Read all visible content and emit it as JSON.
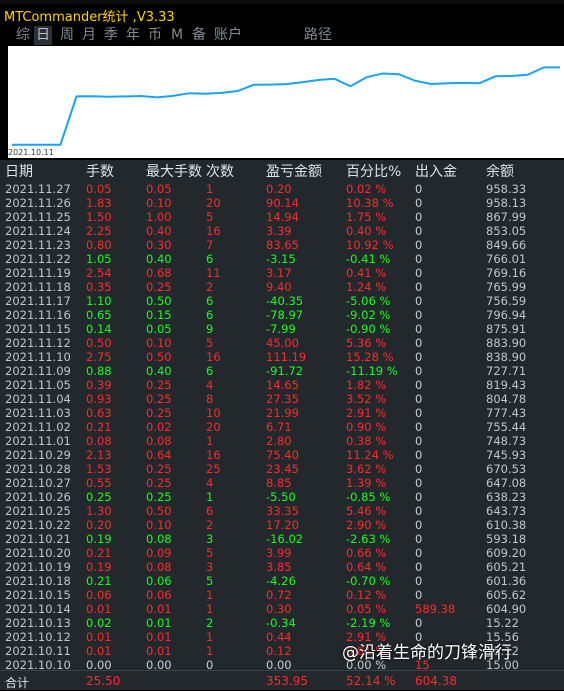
{
  "window": {
    "title": "MTCommander统计 ,V3.33"
  },
  "tabs": [
    {
      "label": "综",
      "selected": false
    },
    {
      "label": "日",
      "selected": true
    },
    {
      "label": "周",
      "selected": false
    },
    {
      "label": "月",
      "selected": false
    },
    {
      "label": "季",
      "selected": false
    },
    {
      "label": "年",
      "selected": false
    },
    {
      "label": "币",
      "selected": false
    },
    {
      "label": "M",
      "selected": false
    },
    {
      "label": "备",
      "selected": false
    },
    {
      "label": "账户",
      "selected": false
    },
    {
      "label": "路径",
      "selected": false
    }
  ],
  "chart": {
    "date_label": "2021.10.11"
  },
  "table": {
    "headers": [
      "日期",
      "手数",
      "最大手数",
      "次数",
      "盈亏金额",
      "百分比%",
      "出入金",
      "余额"
    ],
    "rows": [
      {
        "date": "2021.11.27",
        "lots": "0.05",
        "max_lots": "0.05",
        "count": "1",
        "pnl": "0.20",
        "pct": "0.02 %",
        "flow": "0",
        "balance": "958.33",
        "dir": "pos"
      },
      {
        "date": "2021.11.26",
        "lots": "1.83",
        "max_lots": "0.10",
        "count": "20",
        "pnl": "90.14",
        "pct": "10.38 %",
        "flow": "0",
        "balance": "958.13",
        "dir": "pos"
      },
      {
        "date": "2021.11.25",
        "lots": "1.50",
        "max_lots": "1.00",
        "count": "5",
        "pnl": "14.94",
        "pct": "1.75 %",
        "flow": "0",
        "balance": "867.99",
        "dir": "pos"
      },
      {
        "date": "2021.11.24",
        "lots": "2.25",
        "max_lots": "0.40",
        "count": "16",
        "pnl": "3.39",
        "pct": "0.40 %",
        "flow": "0",
        "balance": "853.05",
        "dir": "pos"
      },
      {
        "date": "2021.11.23",
        "lots": "0.80",
        "max_lots": "0.30",
        "count": "7",
        "pnl": "83.65",
        "pct": "10.92 %",
        "flow": "0",
        "balance": "849.66",
        "dir": "pos"
      },
      {
        "date": "2021.11.22",
        "lots": "1.05",
        "max_lots": "0.40",
        "count": "6",
        "pnl": "-3.15",
        "pct": "-0.41 %",
        "flow": "0",
        "balance": "766.01",
        "dir": "neg"
      },
      {
        "date": "2021.11.19",
        "lots": "2.54",
        "max_lots": "0.68",
        "count": "11",
        "pnl": "3.17",
        "pct": "0.41 %",
        "flow": "0",
        "balance": "769.16",
        "dir": "pos"
      },
      {
        "date": "2021.11.18",
        "lots": "0.35",
        "max_lots": "0.25",
        "count": "2",
        "pnl": "9.40",
        "pct": "1.24 %",
        "flow": "0",
        "balance": "765.99",
        "dir": "pos"
      },
      {
        "date": "2021.11.17",
        "lots": "1.10",
        "max_lots": "0.50",
        "count": "6",
        "pnl": "-40.35",
        "pct": "-5.06 %",
        "flow": "0",
        "balance": "756.59",
        "dir": "neg"
      },
      {
        "date": "2021.11.16",
        "lots": "0.65",
        "max_lots": "0.15",
        "count": "6",
        "pnl": "-78.97",
        "pct": "-9.02 %",
        "flow": "0",
        "balance": "796.94",
        "dir": "neg"
      },
      {
        "date": "2021.11.15",
        "lots": "0.14",
        "max_lots": "0.05",
        "count": "9",
        "pnl": "-7.99",
        "pct": "-0.90 %",
        "flow": "0",
        "balance": "875.91",
        "dir": "neg"
      },
      {
        "date": "2021.11.12",
        "lots": "0.50",
        "max_lots": "0.10",
        "count": "5",
        "pnl": "45.00",
        "pct": "5.36 %",
        "flow": "0",
        "balance": "883.90",
        "dir": "pos"
      },
      {
        "date": "2021.11.10",
        "lots": "2.75",
        "max_lots": "0.50",
        "count": "16",
        "pnl": "111.19",
        "pct": "15.28 %",
        "flow": "0",
        "balance": "838.90",
        "dir": "pos"
      },
      {
        "date": "2021.11.09",
        "lots": "0.88",
        "max_lots": "0.40",
        "count": "6",
        "pnl": "-91.72",
        "pct": "-11.19 %",
        "flow": "0",
        "balance": "727.71",
        "dir": "neg"
      },
      {
        "date": "2021.11.05",
        "lots": "0.39",
        "max_lots": "0.25",
        "count": "4",
        "pnl": "14.65",
        "pct": "1.82 %",
        "flow": "0",
        "balance": "819.43",
        "dir": "pos"
      },
      {
        "date": "2021.11.04",
        "lots": "0.93",
        "max_lots": "0.25",
        "count": "8",
        "pnl": "27.35",
        "pct": "3.52 %",
        "flow": "0",
        "balance": "804.78",
        "dir": "pos"
      },
      {
        "date": "2021.11.03",
        "lots": "0.63",
        "max_lots": "0.25",
        "count": "10",
        "pnl": "21.99",
        "pct": "2.91 %",
        "flow": "0",
        "balance": "777.43",
        "dir": "pos"
      },
      {
        "date": "2021.11.02",
        "lots": "0.21",
        "max_lots": "0.02",
        "count": "20",
        "pnl": "6.71",
        "pct": "0.90 %",
        "flow": "0",
        "balance": "755.44",
        "dir": "pos"
      },
      {
        "date": "2021.11.01",
        "lots": "0.08",
        "max_lots": "0.08",
        "count": "1",
        "pnl": "2.80",
        "pct": "0.38 %",
        "flow": "0",
        "balance": "748.73",
        "dir": "pos"
      },
      {
        "date": "2021.10.29",
        "lots": "2.13",
        "max_lots": "0.64",
        "count": "16",
        "pnl": "75.40",
        "pct": "11.24 %",
        "flow": "0",
        "balance": "745.93",
        "dir": "pos"
      },
      {
        "date": "2021.10.28",
        "lots": "1.53",
        "max_lots": "0.25",
        "count": "25",
        "pnl": "23.45",
        "pct": "3.62 %",
        "flow": "0",
        "balance": "670.53",
        "dir": "pos"
      },
      {
        "date": "2021.10.27",
        "lots": "0.55",
        "max_lots": "0.25",
        "count": "4",
        "pnl": "8.85",
        "pct": "1.39 %",
        "flow": "0",
        "balance": "647.08",
        "dir": "pos"
      },
      {
        "date": "2021.10.26",
        "lots": "0.25",
        "max_lots": "0.25",
        "count": "1",
        "pnl": "-5.50",
        "pct": "-0.85 %",
        "flow": "0",
        "balance": "638.23",
        "dir": "neg"
      },
      {
        "date": "2021.10.25",
        "lots": "1.30",
        "max_lots": "0.50",
        "count": "6",
        "pnl": "33.35",
        "pct": "5.46 %",
        "flow": "0",
        "balance": "643.73",
        "dir": "pos"
      },
      {
        "date": "2021.10.22",
        "lots": "0.20",
        "max_lots": "0.10",
        "count": "2",
        "pnl": "17.20",
        "pct": "2.90 %",
        "flow": "0",
        "balance": "610.38",
        "dir": "pos"
      },
      {
        "date": "2021.10.21",
        "lots": "0.19",
        "max_lots": "0.08",
        "count": "3",
        "pnl": "-16.02",
        "pct": "-2.63 %",
        "flow": "0",
        "balance": "593.18",
        "dir": "neg"
      },
      {
        "date": "2021.10.20",
        "lots": "0.21",
        "max_lots": "0.09",
        "count": "5",
        "pnl": "3.99",
        "pct": "0.66 %",
        "flow": "0",
        "balance": "609.20",
        "dir": "pos"
      },
      {
        "date": "2021.10.19",
        "lots": "0.19",
        "max_lots": "0.08",
        "count": "3",
        "pnl": "3.85",
        "pct": "0.64 %",
        "flow": "0",
        "balance": "605.21",
        "dir": "pos"
      },
      {
        "date": "2021.10.18",
        "lots": "0.21",
        "max_lots": "0.06",
        "count": "5",
        "pnl": "-4.26",
        "pct": "-0.70 %",
        "flow": "0",
        "balance": "601.36",
        "dir": "neg"
      },
      {
        "date": "2021.10.15",
        "lots": "0.06",
        "max_lots": "0.06",
        "count": "1",
        "pnl": "0.72",
        "pct": "0.12 %",
        "flow": "0",
        "balance": "605.62",
        "dir": "pos"
      },
      {
        "date": "2021.10.14",
        "lots": "0.01",
        "max_lots": "0.01",
        "count": "1",
        "pnl": "0.30",
        "pct": "0.05 %",
        "flow": "589.38",
        "balance": "604.90",
        "dir": "pos",
        "flow_pos": true
      },
      {
        "date": "2021.10.13",
        "lots": "0.02",
        "max_lots": "0.01",
        "count": "2",
        "pnl": "-0.34",
        "pct": "-2.19 %",
        "flow": "0",
        "balance": "15.22",
        "dir": "neg"
      },
      {
        "date": "2021.10.12",
        "lots": "0.01",
        "max_lots": "0.01",
        "count": "1",
        "pnl": "0.44",
        "pct": "2.91 %",
        "flow": "0",
        "balance": "15.56",
        "dir": "pos"
      },
      {
        "date": "2021.10.11",
        "lots": "0.01",
        "max_lots": "0.01",
        "count": "1",
        "pnl": "0.12",
        "pct": "0.81 %",
        "flow": "0",
        "balance": "15.12",
        "dir": "pos"
      },
      {
        "date": "2021.10.10",
        "lots": "0.00",
        "max_lots": "0.00",
        "count": "0",
        "pnl": "0.00",
        "pct": "0.00 %",
        "flow": "15",
        "balance": "15.00",
        "dir": "zero",
        "flow_pos": true
      }
    ],
    "total": {
      "label": "合计",
      "lots": "25.50",
      "pnl": "353.95",
      "pct": "52.14 %",
      "flow": "604.38"
    }
  },
  "watermark": {
    "text": "@沿着生命的刀锋滑行"
  },
  "colors": {
    "positive": "#ff2a2a",
    "negative": "#19ff19",
    "neutral": "#c8ced4",
    "line": "#1aa3f5",
    "title": "#ffd400"
  }
}
